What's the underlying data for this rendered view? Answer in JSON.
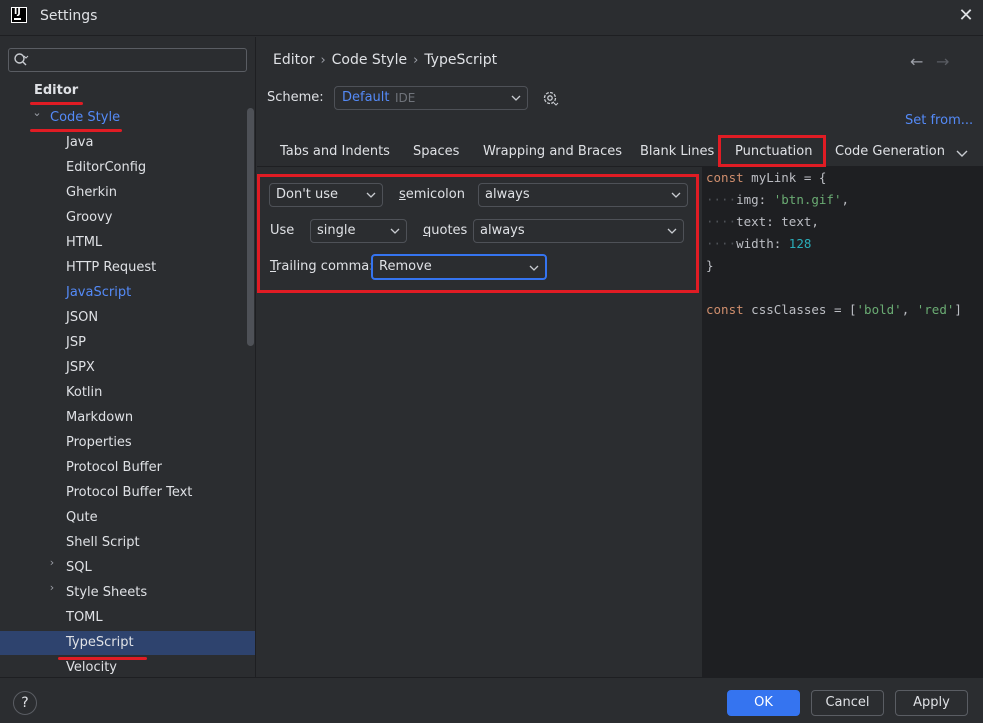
{
  "window": {
    "title": "Settings"
  },
  "search": {
    "value": "",
    "placeholder": ""
  },
  "sidebar": {
    "root_label": "Editor",
    "group_label": "Code Style",
    "items": [
      {
        "label": "Java"
      },
      {
        "label": "EditorConfig"
      },
      {
        "label": "Gherkin"
      },
      {
        "label": "Groovy"
      },
      {
        "label": "HTML"
      },
      {
        "label": "HTTP Request"
      },
      {
        "label": "JavaScript"
      },
      {
        "label": "JSON"
      },
      {
        "label": "JSP"
      },
      {
        "label": "JSPX"
      },
      {
        "label": "Kotlin"
      },
      {
        "label": "Markdown"
      },
      {
        "label": "Properties"
      },
      {
        "label": "Protocol Buffer"
      },
      {
        "label": "Protocol Buffer Text"
      },
      {
        "label": "Qute"
      },
      {
        "label": "Shell Script"
      },
      {
        "label": "SQL"
      },
      {
        "label": "Style Sheets"
      },
      {
        "label": "TOML"
      },
      {
        "label": "TypeScript"
      },
      {
        "label": "Velocity"
      }
    ]
  },
  "breadcrumb": [
    "Editor",
    "Code Style",
    "TypeScript"
  ],
  "scheme": {
    "label": "Scheme:",
    "name": "Default",
    "kind": "IDE",
    "set_from": "Set from..."
  },
  "tabs": [
    {
      "label": "Tabs and Indents"
    },
    {
      "label": "Spaces"
    },
    {
      "label": "Wrapping and Braces"
    },
    {
      "label": "Blank Lines"
    },
    {
      "label": "Punctuation"
    },
    {
      "label": "Code Generation"
    }
  ],
  "punctuation": {
    "semicolon_mode": "Don't use",
    "semicolon_label_first": "s",
    "semicolon_label_rest": "emicolon",
    "semicolon_when": "always",
    "quotes_mode": "Use",
    "quotes_type": "single",
    "quotes_label_first": "q",
    "quotes_label_rest": "uotes",
    "quotes_when": "always",
    "trailing_label_first": "T",
    "trailing_label_rest": "railing comma:",
    "trailing_value": "Remove"
  },
  "preview": {
    "l1_kw": "const",
    "l1_rest": " myLink = {",
    "l2_ws": "····",
    "l2_key": "img: ",
    "l2_str": "'btn.gif'",
    "l2_end": ",",
    "l3_ws": "····",
    "l3_text": "text: text,",
    "l4_ws": "····",
    "l4_key": "width: ",
    "l4_num": "128",
    "l5": "}",
    "l7_kw": "const",
    "l7_mid": " cssClasses = [",
    "l7_s1": "'bold'",
    "l7_sep": ", ",
    "l7_s2": "'red'",
    "l7_end": "]"
  },
  "footer": {
    "help": "?",
    "ok": "OK",
    "cancel": "Cancel",
    "apply": "Apply"
  },
  "colors": {
    "accent": "#3574f0",
    "highlight_red": "#e01c24",
    "link": "#548af7",
    "selection": "#2e436e"
  }
}
